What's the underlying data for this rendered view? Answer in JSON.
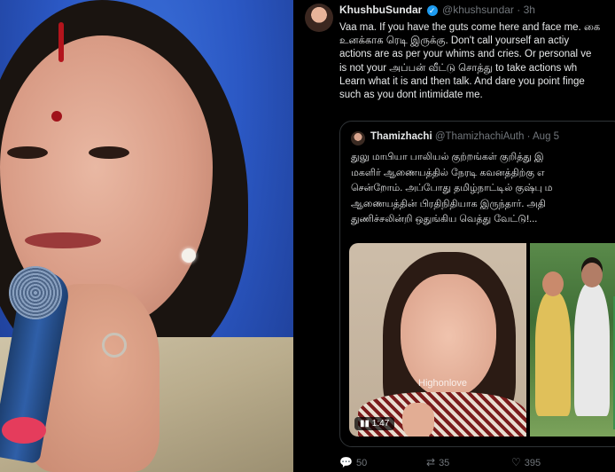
{
  "tweet": {
    "author_name": "KhushbuSundar",
    "handle": "@khushsundar",
    "separator": "·",
    "time": "3h",
    "lines": [
      "Vaa ma. If you have the guts come here and face me. கை",
      "உனக்காக ரெடி இருக்கு.  Don't call yourself an actiу",
      "actions are as per your whims and cries. Or personal ve",
      "is not your அப்பன் வீட்டு சொத்து to take actions wh",
      "Learn what it is and then talk. And dare you point finge",
      "such as you dont intimidate me."
    ],
    "quoted": {
      "author_name": "Thamizhachi",
      "handle": "@ThamizhachiAuth",
      "separator": "·",
      "time": "Aug 5",
      "lines": [
        "துலு மாபியா பாலியல் குற்றங்கள் குறித்து இ",
        "மகளிர் ஆணையத்தில் நேரடி கவனத்திற்கு எ",
        "சென்றோம். அப்போது தமிழ்நாட்டில் குஷ்பு ம",
        "ஆணையத்தின் பிரதிநிதியாக இருந்தார். அதி",
        "துணிச்சலின்றி ஒதுங்கிய வெத்து வேட்டு!..."
      ],
      "media": {
        "watermark": "Highonlove",
        "duration": "1:47"
      }
    },
    "actions": {
      "replies": "50",
      "reposts": "35",
      "likes": "395"
    }
  },
  "icons": {
    "verified": "verified-badge-icon",
    "reply": "reply-icon",
    "repost": "repost-icon",
    "like": "heart-icon",
    "play": "play-icon"
  },
  "colors": {
    "background": "#000000",
    "text": "#e7e9ea",
    "muted": "#71767b",
    "verified": "#1d9bf0",
    "border": "#2f3336"
  }
}
